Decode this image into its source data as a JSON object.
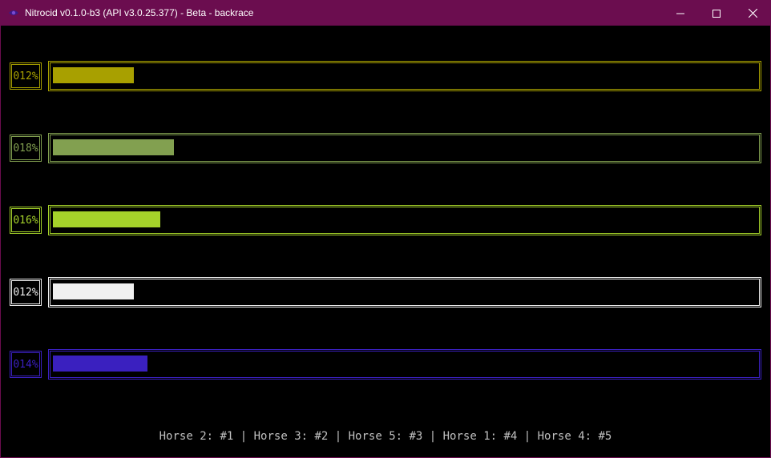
{
  "window": {
    "title": "Nitrocid v0.1.0-b3 (API v3.0.25.377) - Beta - backrace",
    "titlebar_color": "#6b0d4f",
    "icon": "nitrocid-eye-icon",
    "controls": [
      "minimize-icon",
      "maximize-icon",
      "close-icon"
    ]
  },
  "horses": [
    {
      "number": 1,
      "percent_label": "012%",
      "progress": 0.12,
      "color": "#a8a000"
    },
    {
      "number": 2,
      "percent_label": "018%",
      "progress": 0.18,
      "color": "#82a050"
    },
    {
      "number": 3,
      "percent_label": "016%",
      "progress": 0.16,
      "color": "#a5d22a"
    },
    {
      "number": 4,
      "percent_label": "012%",
      "progress": 0.12,
      "color": "#f0f0f0"
    },
    {
      "number": 5,
      "percent_label": "014%",
      "progress": 0.14,
      "color": "#3a20bf"
    }
  ],
  "ranking": "Horse 2: #1 | Horse 3: #2 | Horse 5: #3 | Horse 1: #4 | Horse 4: #5",
  "colors": {
    "background": "#000000",
    "ranking_text": "#c0c0c0",
    "titlebar_text": "#ffffff"
  }
}
